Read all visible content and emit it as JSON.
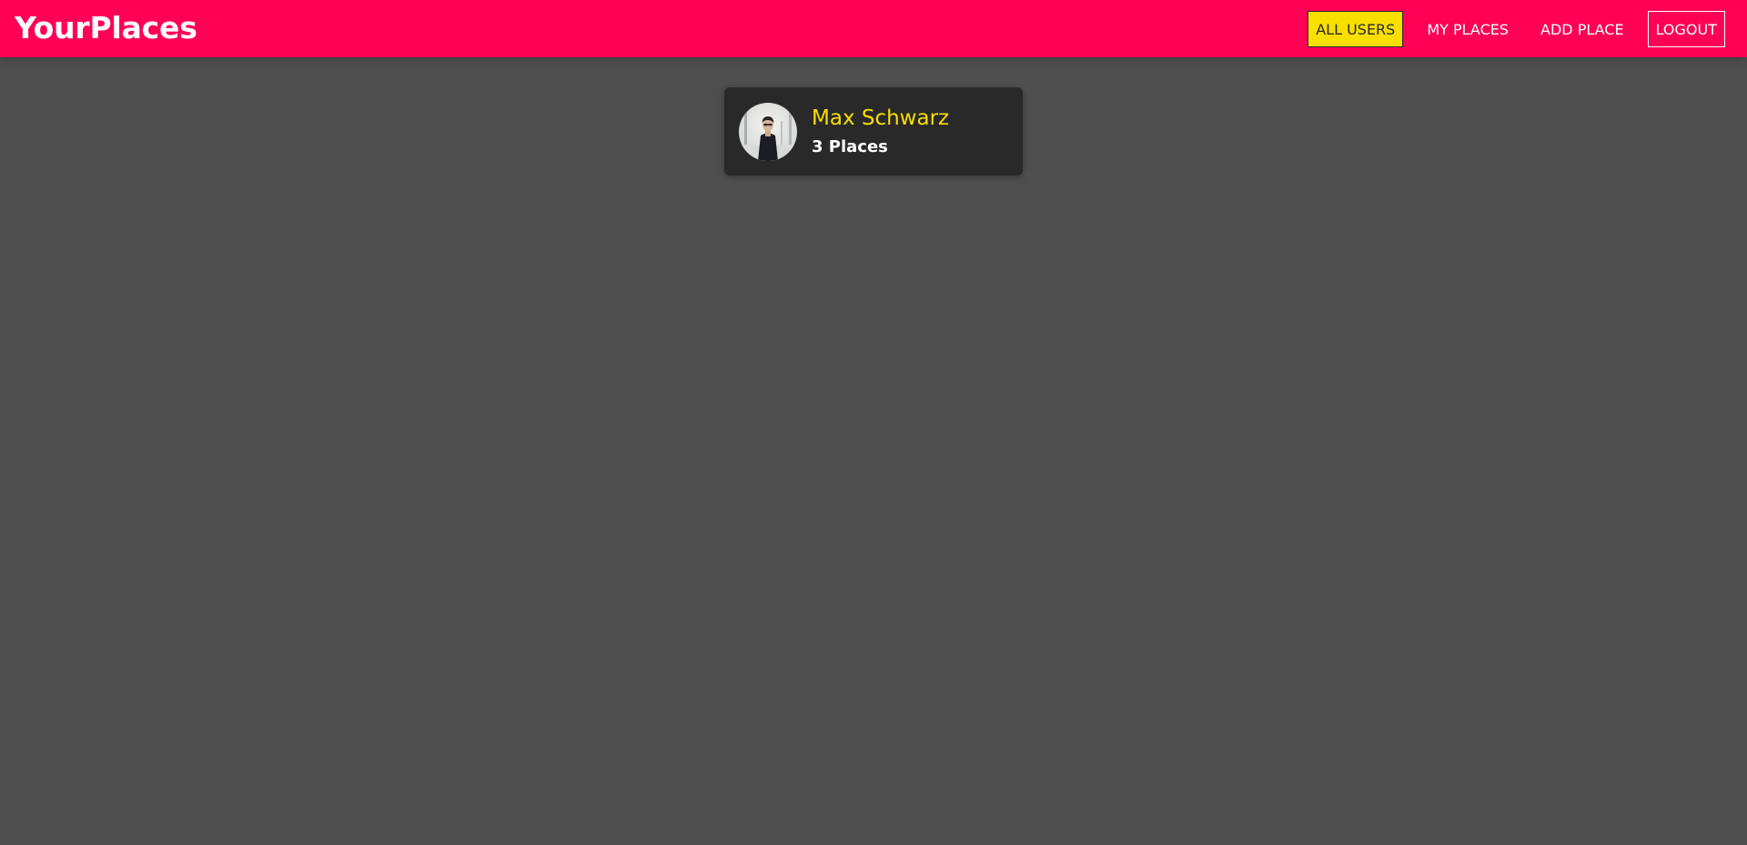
{
  "brand": {
    "title": "YourPlaces"
  },
  "nav": {
    "items": [
      {
        "label": "ALL USERS",
        "active": true
      },
      {
        "label": "MY PLACES",
        "active": false
      },
      {
        "label": "ADD PLACE",
        "active": false
      },
      {
        "label": "LOGOUT",
        "active": false
      }
    ]
  },
  "users": [
    {
      "name": "Max Schwarz",
      "places_label": "3 Places",
      "avatar_icon": "user-photo"
    }
  ],
  "colors": {
    "header": "#ff0055",
    "background": "#4f4f4f",
    "card": "#292929",
    "accent": "#f8df00",
    "text": "#ffffff"
  }
}
